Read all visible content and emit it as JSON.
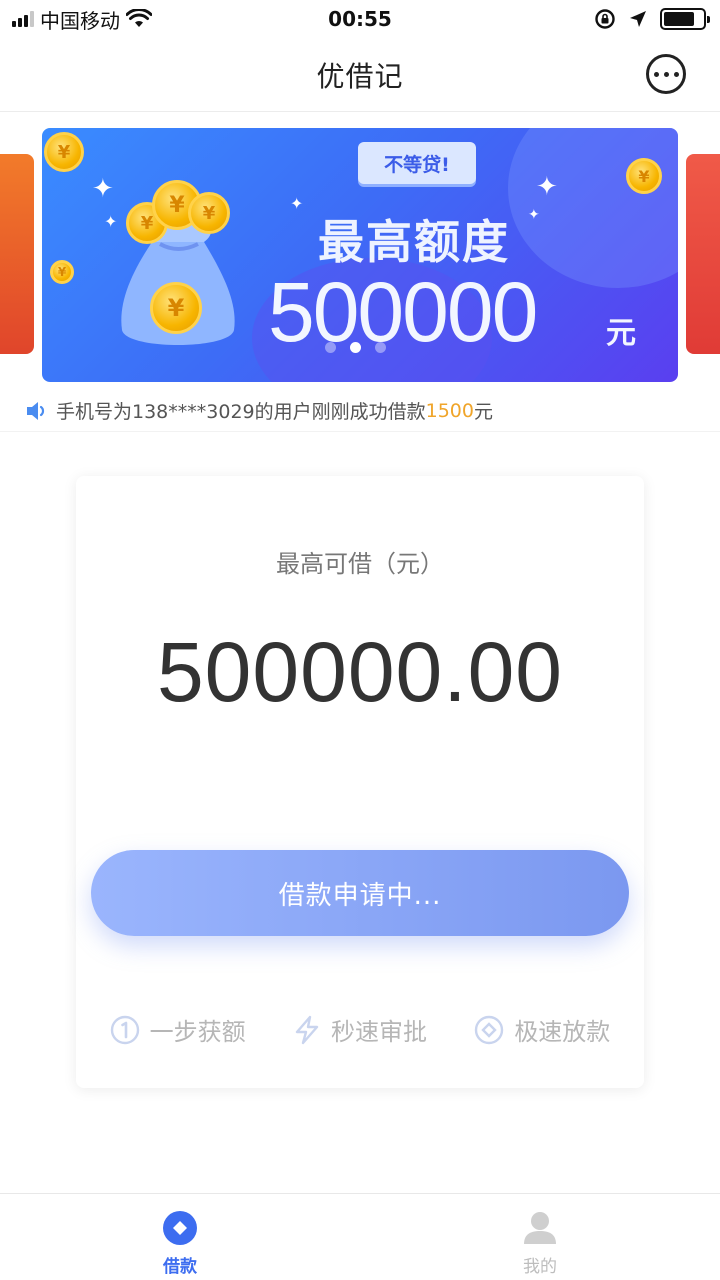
{
  "status_bar": {
    "carrier": "中国移动",
    "time": "00:55"
  },
  "nav": {
    "title": "优借记",
    "more_icon": "more-dots-icon"
  },
  "banner": {
    "tag": "不等贷!",
    "headline": "最高额度",
    "amount": "500000",
    "unit": "元",
    "coin_symbol": "¥",
    "slide_count": 3,
    "active_slide": 2
  },
  "notice": {
    "prefix": "手机号为138****3029的用户刚刚成功借款",
    "amount": "1500",
    "suffix": "元",
    "highlight_color": "#f0a52a"
  },
  "card": {
    "label": "最高可借（元）",
    "amount": "500000.00",
    "button_label": "借款申请中...",
    "features": [
      {
        "icon": "number-one-icon",
        "label": "一步获额"
      },
      {
        "icon": "lightning-icon",
        "label": "秒速审批"
      },
      {
        "icon": "diamond-circle-icon",
        "label": "极速放款"
      }
    ]
  },
  "tabs": [
    {
      "label": "借款",
      "icon": "loan-icon",
      "active": true
    },
    {
      "label": "我的",
      "icon": "profile-icon",
      "active": false
    }
  ],
  "colors": {
    "accent": "#3d6df0",
    "button_start": "#9ab5fd",
    "button_end": "#7b98f0"
  }
}
